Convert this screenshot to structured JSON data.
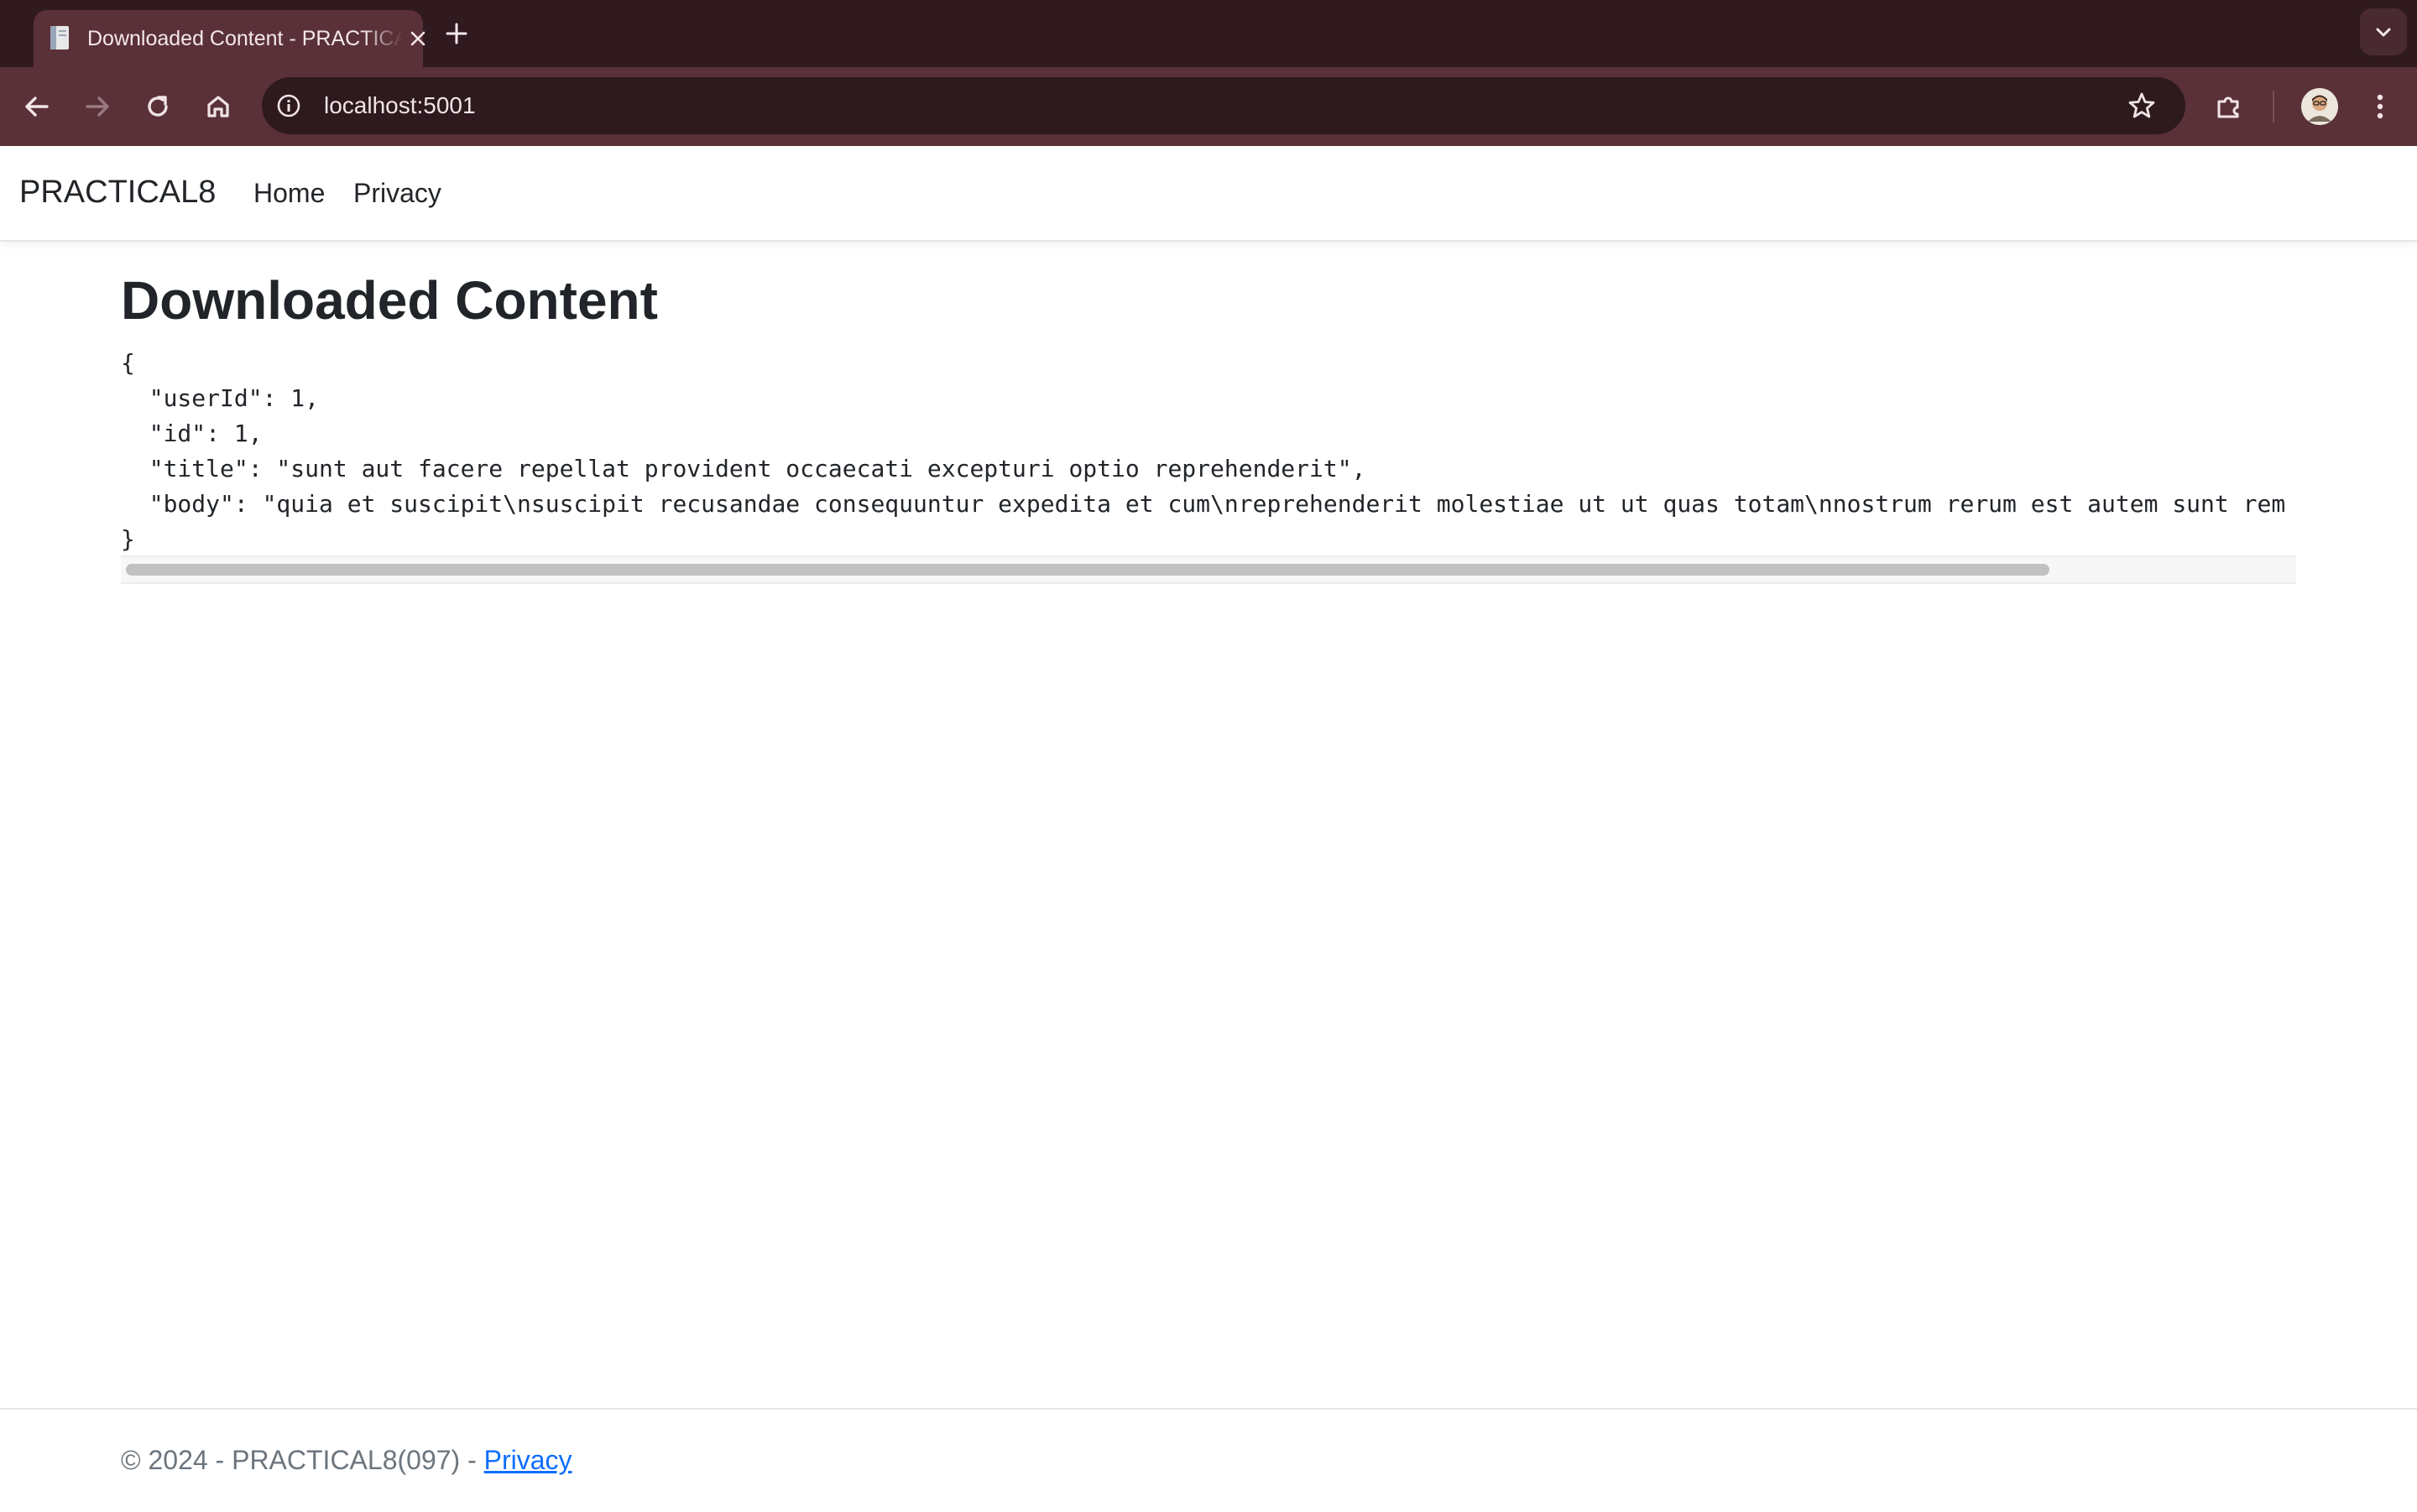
{
  "browser": {
    "tab": {
      "title": "Downloaded Content - PRACTICAL8"
    },
    "address_bar": {
      "url": "localhost:5001"
    },
    "colors": {
      "frame": "#301a20",
      "toolbar": "#5a3138",
      "omnibox": "#2e1a1e"
    }
  },
  "navbar": {
    "brand": "PRACTICAL8",
    "links": [
      {
        "label": "Home"
      },
      {
        "label": "Privacy"
      }
    ]
  },
  "main": {
    "title": "Downloaded Content",
    "json_lines": [
      "{",
      "  \"userId\": 1,",
      "  \"id\": 1,",
      "  \"title\": \"sunt aut facere repellat provident occaecati excepturi optio reprehenderit\",",
      "  \"body\": \"quia et suscipit\\nsuscipit recusandae consequuntur expedita et cum\\nreprehenderit molestiae ut ut quas totam\\nnostrum rerum est autem sunt rem",
      "}"
    ]
  },
  "footer": {
    "copyright": "© 2024 - PRACTICAL8(097) - ",
    "privacy_link": "Privacy"
  }
}
